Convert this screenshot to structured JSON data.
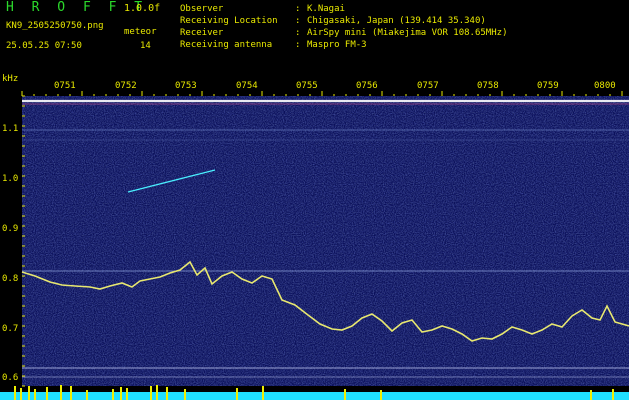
{
  "header": {
    "logo": "H R O F F T",
    "version": "1.0.0f",
    "filename": "KN9_2505250750.png",
    "mode": "meteor",
    "datetime": "25.05.25 07:50",
    "count": "14",
    "info": [
      {
        "key": "Observer",
        "value": "K.Nagai"
      },
      {
        "key": "Receiving Location",
        "value": "Chigasaki, Japan (139.414 35.340)"
      },
      {
        "key": "Receiver",
        "value": "AirSpy mini (Miakejima VOR 108.65MHz)"
      },
      {
        "key": "Receiving antenna",
        "value": "Maspro FM-3"
      }
    ]
  },
  "plot": {
    "freq_unit": "kHz",
    "y_ticks": [
      "1.1",
      "1.0",
      "0.9",
      "0.8",
      "0.7",
      "0.6"
    ],
    "x_ticks": [
      "0751",
      "0752",
      "0753",
      "0754",
      "0755",
      "0756",
      "0757",
      "0758",
      "0759",
      "0800"
    ],
    "colors": {
      "background": "#0a0f5a",
      "trace": "#e8e870",
      "label": "#e8e800",
      "level_bar": "#20e0ff",
      "level_peak": "#f0f000"
    }
  }
}
